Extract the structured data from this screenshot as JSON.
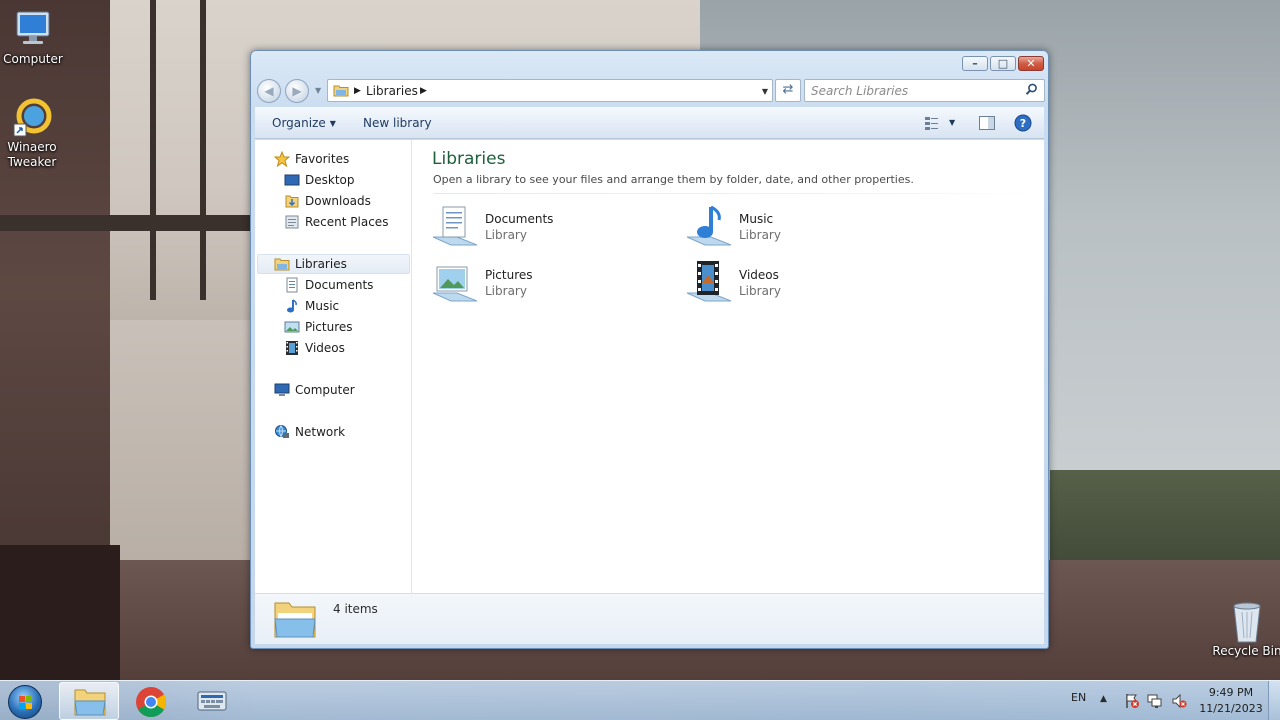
{
  "desktop": {
    "icons": [
      {
        "label": "Computer",
        "icon": "computer-icon"
      },
      {
        "label": "Winaero Tweaker",
        "label_line1": "Winaero",
        "label_line2": "Tweaker",
        "icon": "winaero-tweaker-icon"
      },
      {
        "label": "Recycle Bin",
        "icon": "recycle-bin-icon"
      }
    ]
  },
  "window": {
    "caption_buttons": {
      "minimize": "minimize",
      "maximize": "maximize",
      "close": "close"
    },
    "address": {
      "crumb": "Libraries"
    },
    "search": {
      "placeholder": "Search Libraries"
    },
    "toolbar": {
      "organize": "Organize",
      "new_library": "New library"
    },
    "navpane": {
      "favorites": {
        "label": "Favorites",
        "items": [
          "Desktop",
          "Downloads",
          "Recent Places"
        ]
      },
      "libraries": {
        "label": "Libraries",
        "items": [
          "Documents",
          "Music",
          "Pictures",
          "Videos"
        ]
      },
      "computer": "Computer",
      "network": "Network"
    },
    "main": {
      "title": "Libraries",
      "subtitle": "Open a library to see your files and arrange them by folder, date, and other properties.",
      "items": [
        {
          "name": "Documents",
          "kind": "Library",
          "icon": "documents-library-icon"
        },
        {
          "name": "Music",
          "kind": "Library",
          "icon": "music-library-icon"
        },
        {
          "name": "Pictures",
          "kind": "Library",
          "icon": "pictures-library-icon"
        },
        {
          "name": "Videos",
          "kind": "Library",
          "icon": "videos-library-icon"
        }
      ]
    },
    "details": {
      "count": "4 items"
    }
  },
  "taskbar": {
    "apps": [
      "windows-explorer",
      "google-chrome",
      "on-screen-keyboard"
    ],
    "language": "EN",
    "time": "9:49 PM",
    "date": "11/21/2023"
  },
  "colors": {
    "accent": "#1e5f3c",
    "window_frame": "#c6d8ed",
    "close_button": "#c8452c"
  }
}
